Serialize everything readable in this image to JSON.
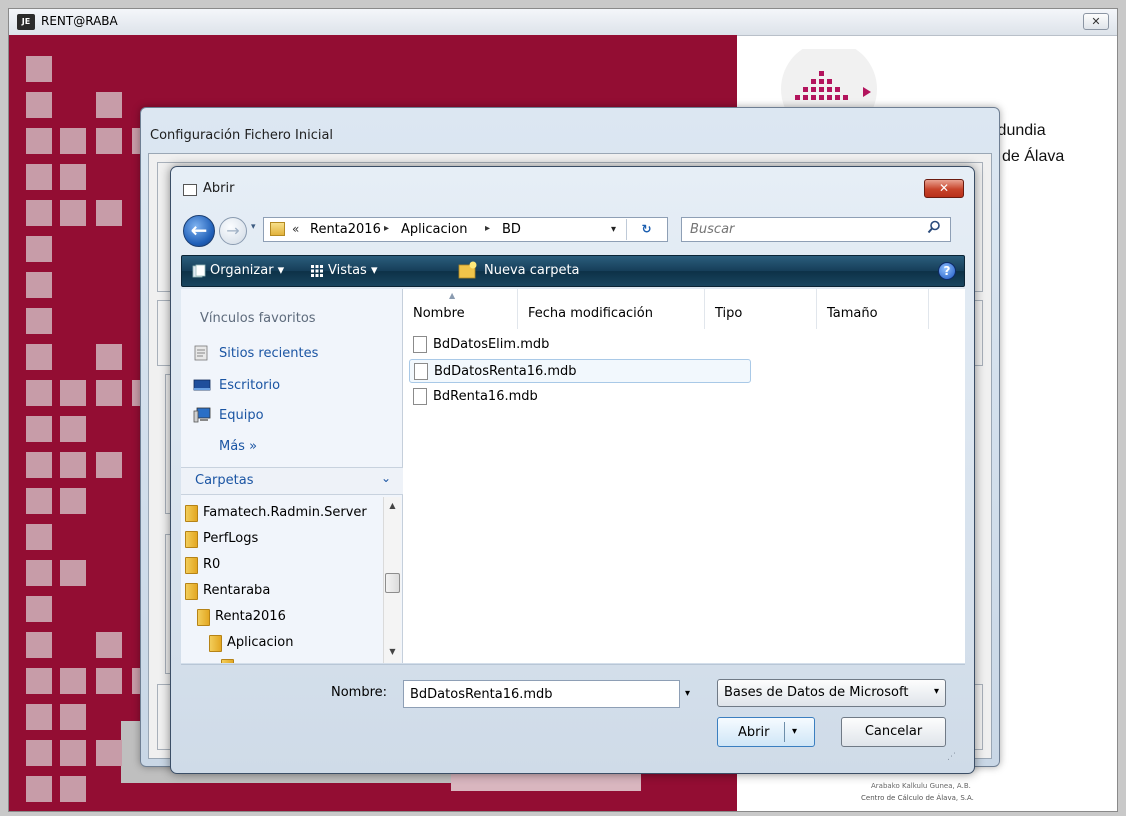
{
  "main_window": {
    "title": "RENT@RABA",
    "app_icon_label": "JE",
    "close_symbol": "✕"
  },
  "brand": {
    "line1": "ldundia",
    "line2": "l de Álava",
    "footer_line1": "Arabako Kalkulu Gunea, A.B.",
    "footer_line2": "Centro de Cálculo de Álava, S.A."
  },
  "config_dialog": {
    "title": "Configuración Fichero Inicial"
  },
  "open_dialog": {
    "title": "Abrir",
    "close_symbol": "✕",
    "nav": {
      "back_symbol": "←",
      "forward_symbol": "→",
      "history_symbol": "▾"
    },
    "breadcrumb": {
      "chevron": "«",
      "segments": [
        "Renta2016",
        "Aplicacion",
        "BD"
      ],
      "separator": "▸",
      "dropdown_symbol": "▾",
      "refresh_symbol": "↻"
    },
    "search": {
      "placeholder": "Buscar"
    },
    "toolbar": {
      "organize": "Organizar ▾",
      "views": "Vistas ▾",
      "new_folder": "Nueva carpeta",
      "help": "?"
    },
    "favorites": {
      "title": "Vínculos favoritos",
      "items": [
        "Sitios recientes",
        "Escritorio",
        "Equipo"
      ],
      "more": "Más »"
    },
    "folders": {
      "title": "Carpetas",
      "toggle_symbol": "⌄",
      "tree": [
        "Famatech.Radmin.Server",
        "PerfLogs",
        "R0",
        "Rentaraba",
        "Renta2016",
        "Aplicacion"
      ]
    },
    "columns": [
      "Nombre",
      "Fecha modificación",
      "Tipo",
      "Tamaño"
    ],
    "sort_indicator": "▲",
    "files": [
      {
        "name": "BdDatosElim.mdb",
        "selected": false
      },
      {
        "name": "BdDatosRenta16.mdb",
        "selected": true
      },
      {
        "name": "BdRenta16.mdb",
        "selected": false
      }
    ],
    "filename": {
      "label": "Nombre:",
      "value": "BdDatosRenta16.mdb",
      "dropdown_symbol": "▾"
    },
    "filetype": {
      "value": "Bases de Datos de Microsoft",
      "dropdown_symbol": "▾"
    },
    "buttons": {
      "open": "Abrir",
      "open_arrow": "▾",
      "cancel": "Cancelar"
    },
    "scroll": {
      "up": "▲",
      "down": "▼"
    },
    "grip": "⋰"
  },
  "colors": {
    "maroon": "#930d33",
    "toolbar": "#163e59",
    "link": "#1b55a3",
    "brand_magenta": "#b3145d"
  }
}
